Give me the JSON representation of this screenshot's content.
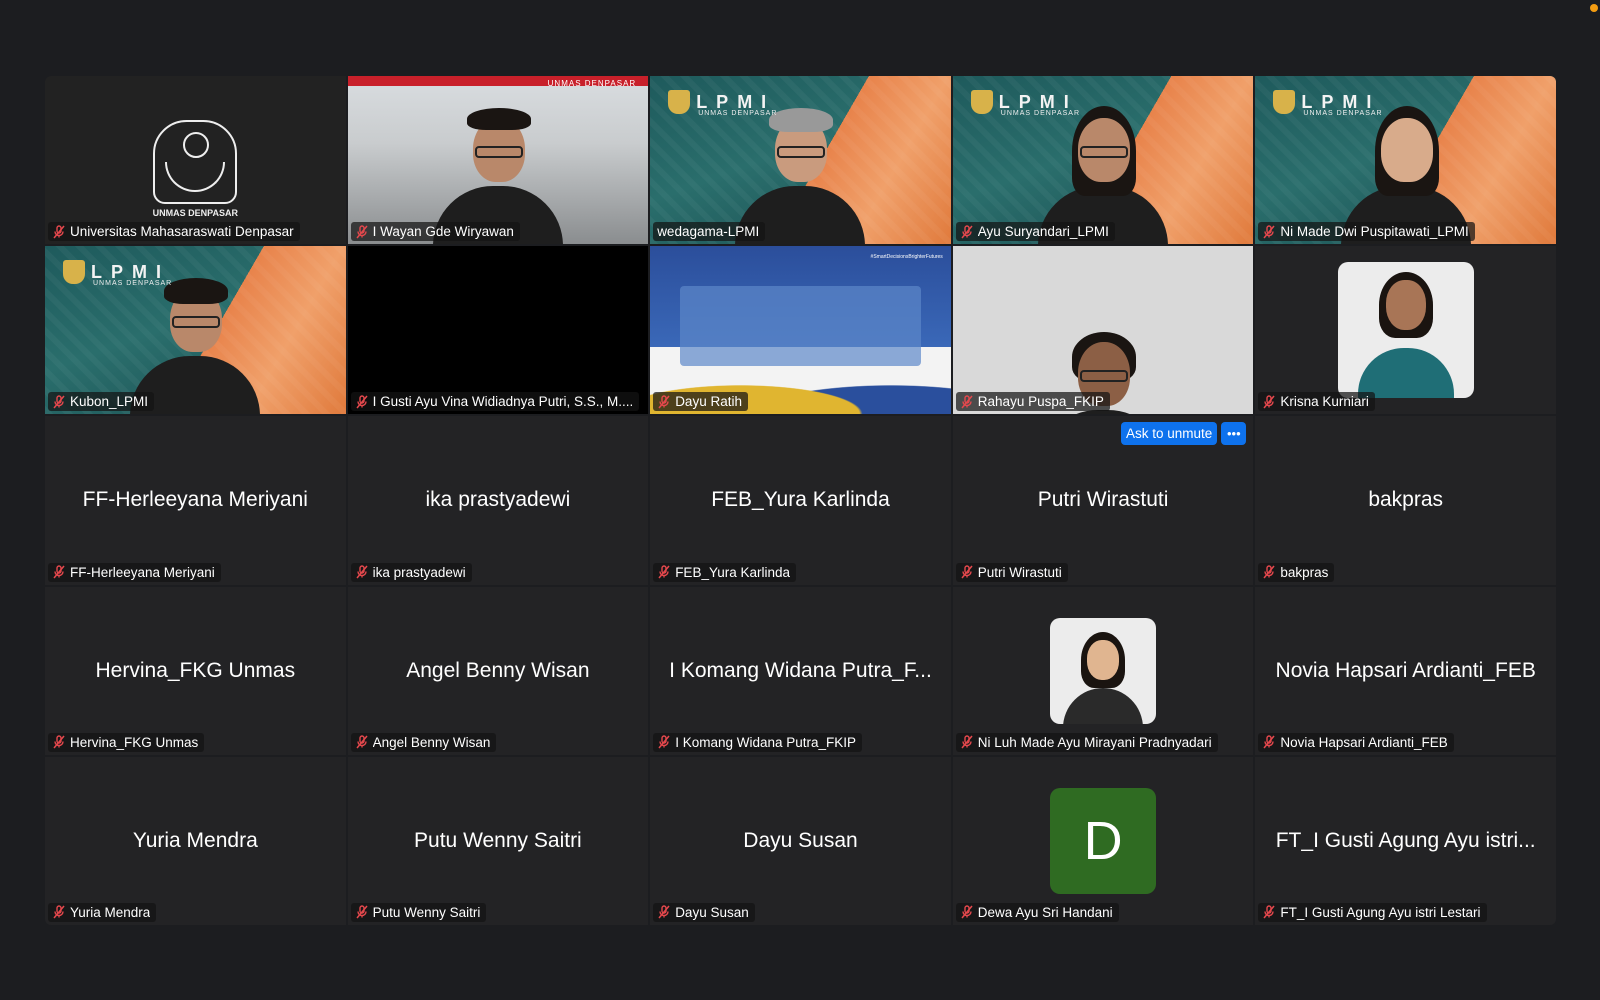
{
  "meeting": {
    "unmute_button": "Ask to unmute",
    "more_button": "•••",
    "accent_color": "#0e72ed",
    "active_speaker_color": "#3bd14a"
  },
  "tiles": [
    {
      "label": "Universitas Mahasaraswati Denpasar",
      "logo_caption": "UNMAS DENPASAR"
    },
    {
      "label": "I Wayan Gde Wiryawan",
      "banner": "UNMAS DENPASAR"
    },
    {
      "label": "wedagama-LPMI",
      "lpmi": "LPMI",
      "lpmi_sub": "UNMAS DENPASAR"
    },
    {
      "label": "Ayu Suryandari_LPMI",
      "lpmi": "LPMI",
      "lpmi_sub": "UNMAS DENPASAR"
    },
    {
      "label": "Ni Made Dwi Puspitawati_LPMI",
      "lpmi": "LPMI",
      "lpmi_sub": "UNMAS DENPASAR"
    },
    {
      "label": "Kubon_LPMI",
      "lpmi": "LPMI",
      "lpmi_sub": "UNMAS DENPASAR"
    },
    {
      "label": "I Gusti Ayu Vina Widiadnya Putri, S.S., M...."
    },
    {
      "label": "Dayu Ratih",
      "slide_tag": "#SmartDecisionsBrighterFutures"
    },
    {
      "label": "Rahayu Puspa_FKIP"
    },
    {
      "label": "Krisna Kurniari"
    },
    {
      "label": "FF-Herleeyana Meriyani",
      "display": "FF-Herleeyana Meriyani"
    },
    {
      "label": "ika prastyadewi",
      "display": "ika prastyadewi"
    },
    {
      "label": "FEB_Yura Karlinda",
      "display": "FEB_Yura Karlinda"
    },
    {
      "label": "Putri Wirastuti",
      "display": "Putri Wirastuti"
    },
    {
      "label": "bakpras",
      "display": "bakpras"
    },
    {
      "label": "Hervina_FKG Unmas",
      "display": "Hervina_FKG Unmas"
    },
    {
      "label": "Angel Benny Wisan",
      "display": "Angel Benny Wisan"
    },
    {
      "label": "I Komang Widana Putra_FKIP",
      "display": "I Komang Widana Putra_F..."
    },
    {
      "label": "Ni Luh Made Ayu Mirayani Pradnyadari"
    },
    {
      "label": "Novia Hapsari Ardianti_FEB",
      "display": "Novia Hapsari Ardianti_FEB"
    },
    {
      "label": "Yuria Mendra",
      "display": "Yuria Mendra"
    },
    {
      "label": "Putu Wenny Saitri",
      "display": "Putu Wenny Saitri"
    },
    {
      "label": "Dayu Susan",
      "display": "Dayu Susan"
    },
    {
      "label": "Dewa Ayu Sri Handani",
      "avatar_letter": "D"
    },
    {
      "label": "FT_I Gusti Agung Ayu istri Lestari",
      "display": "FT_I Gusti Agung Ayu istri..."
    }
  ]
}
